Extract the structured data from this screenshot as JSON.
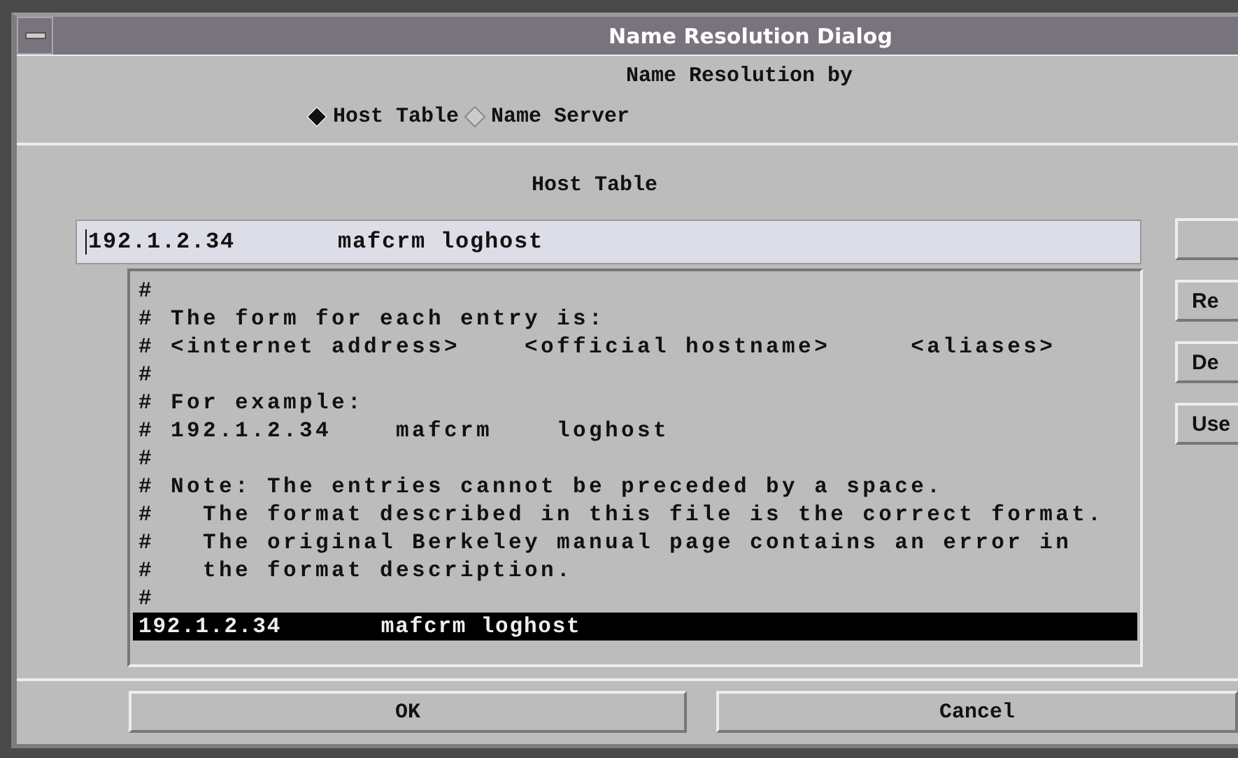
{
  "window": {
    "title": "Name Resolution Dialog"
  },
  "resolution": {
    "heading": "Name Resolution by",
    "options": [
      {
        "label": "Host Table",
        "selected": true
      },
      {
        "label": "Name Server",
        "selected": false
      }
    ]
  },
  "host_table": {
    "heading": "Host Table",
    "entry_field": {
      "value": "192.1.2.34       mafcrm loghost"
    },
    "lines": [
      {
        "text": "#",
        "selected": false
      },
      {
        "text": "# The form for each entry is:",
        "selected": false
      },
      {
        "text": "# <internet address>    <official hostname>     <aliases>",
        "selected": false
      },
      {
        "text": "#",
        "selected": false
      },
      {
        "text": "# For example:",
        "selected": false
      },
      {
        "text": "# 192.1.2.34    mafcrm    loghost",
        "selected": false
      },
      {
        "text": "#",
        "selected": false
      },
      {
        "text": "# Note: The entries cannot be preceded by a space.",
        "selected": false
      },
      {
        "text": "#   The format described in this file is the correct format.",
        "selected": false
      },
      {
        "text": "#   The original Berkeley manual page contains an error in",
        "selected": false
      },
      {
        "text": "#   the format description.",
        "selected": false
      },
      {
        "text": "#",
        "selected": false
      },
      {
        "text": "192.1.2.34       mafcrm loghost",
        "selected": true
      }
    ]
  },
  "side_buttons": [
    {
      "kind": "blank"
    },
    {
      "kind": "text",
      "label": "Re"
    },
    {
      "kind": "text",
      "label": "De"
    },
    {
      "kind": "text",
      "label": "Use"
    }
  ],
  "buttons": [
    "OK",
    "Cancel"
  ]
}
